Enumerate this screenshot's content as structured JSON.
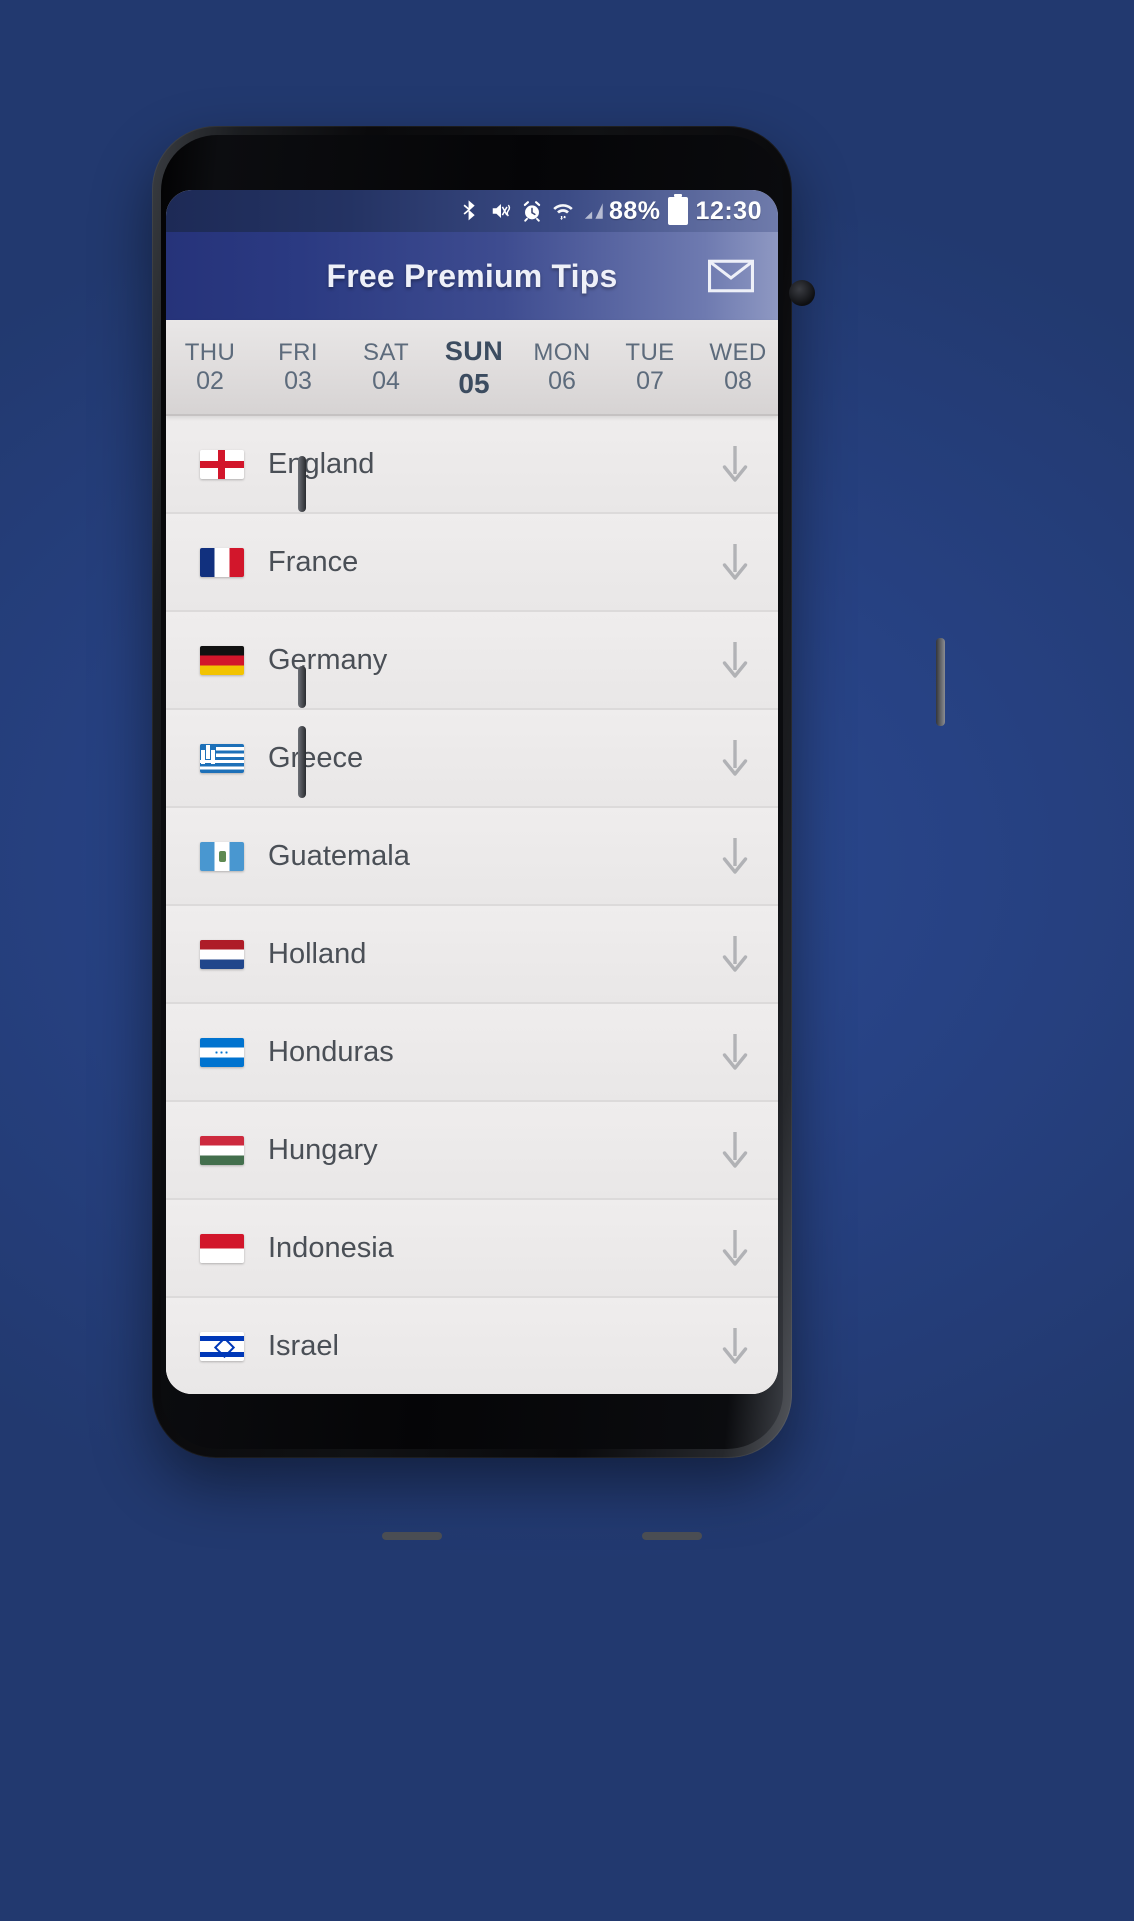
{
  "statusbar": {
    "icons": [
      "bluetooth-icon",
      "mute-vibrate-icon",
      "alarm-icon",
      "wifi-icon",
      "signal-icon"
    ],
    "battery_percent": "88%",
    "time": "12:30"
  },
  "appbar": {
    "title": "Free Premium Tips",
    "mail_icon": "envelope-icon"
  },
  "date_tabs": [
    {
      "dow": "THU",
      "day": "02",
      "active": false
    },
    {
      "dow": "FRI",
      "day": "03",
      "active": false
    },
    {
      "dow": "SAT",
      "day": "04",
      "active": false
    },
    {
      "dow": "SUN",
      "day": "05",
      "active": true
    },
    {
      "dow": "MON",
      "day": "06",
      "active": false
    },
    {
      "dow": "TUE",
      "day": "07",
      "active": false
    },
    {
      "dow": "WED",
      "day": "08",
      "active": false
    }
  ],
  "countries": [
    {
      "name": "England",
      "flag": "f-england",
      "expand_icon": "arrow-down-icon"
    },
    {
      "name": "France",
      "flag": "f-france",
      "expand_icon": "arrow-down-icon"
    },
    {
      "name": "Germany",
      "flag": "f-germany",
      "expand_icon": "arrow-down-icon"
    },
    {
      "name": "Greece",
      "flag": "f-greece",
      "expand_icon": "arrow-down-icon"
    },
    {
      "name": "Guatemala",
      "flag": "f-guatemala",
      "expand_icon": "arrow-down-icon"
    },
    {
      "name": "Holland",
      "flag": "f-holland",
      "expand_icon": "arrow-down-icon"
    },
    {
      "name": "Honduras",
      "flag": "f-honduras",
      "expand_icon": "arrow-down-icon"
    },
    {
      "name": "Hungary",
      "flag": "f-hungary",
      "expand_icon": "arrow-down-icon"
    },
    {
      "name": "Indonesia",
      "flag": "f-indonesia",
      "expand_icon": "arrow-down-icon"
    },
    {
      "name": "Israel",
      "flag": "f-israel",
      "expand_icon": "arrow-down-icon"
    }
  ],
  "colors": {
    "accent": "#26337a",
    "background": "#26407f",
    "list_bg": "#eceaea",
    "text": "#4a4f56"
  }
}
